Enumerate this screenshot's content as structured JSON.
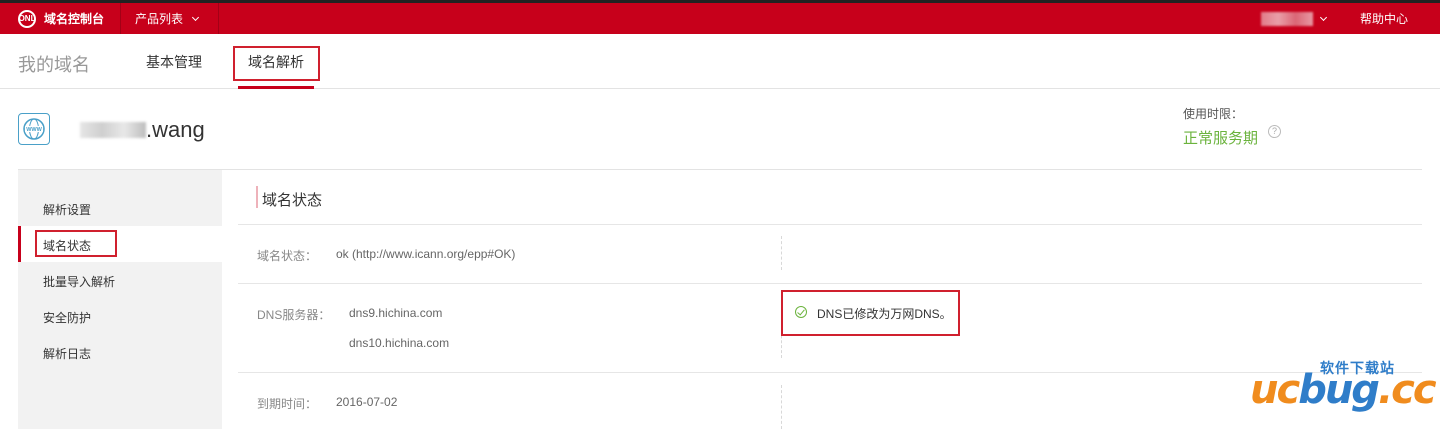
{
  "topbar": {
    "brand_logo_text": "ONL",
    "brand": "域名控制台",
    "products": "产品列表",
    "help": "帮助中心"
  },
  "subnav": {
    "title": "我的域名",
    "tabs": [
      {
        "label": "基本管理"
      },
      {
        "label": "域名解析"
      }
    ]
  },
  "domain": {
    "name_suffix": ".wang",
    "icon_text": "WWW",
    "validity_label": "使用时限：",
    "validity_status": "正常服务期",
    "help_glyph": "?"
  },
  "sidebar": {
    "items": [
      {
        "label": "解析设置"
      },
      {
        "label": "域名状态"
      },
      {
        "label": "批量导入解析"
      },
      {
        "label": "安全防护"
      },
      {
        "label": "解析日志"
      }
    ]
  },
  "content": {
    "section_title": "域名状态",
    "rows": [
      {
        "label": "域名状态：",
        "value": "ok (http://www.icann.org/epp#OK)"
      },
      {
        "label": "DNS服务器：",
        "values": [
          "dns9.hichina.com",
          "dns10.hichina.com"
        ]
      },
      {
        "label": "到期时间：",
        "value": "2016-07-02"
      }
    ],
    "dns_message": "DNS已修改为万网DNS。"
  },
  "watermark": {
    "top": "软件下载站",
    "main_a": "uc",
    "main_b": "bug",
    "main_c": ".cc"
  },
  "colors": {
    "brand_red": "#c7001b",
    "highlight_red": "#d0202e",
    "ok_green": "#6bb33d"
  }
}
